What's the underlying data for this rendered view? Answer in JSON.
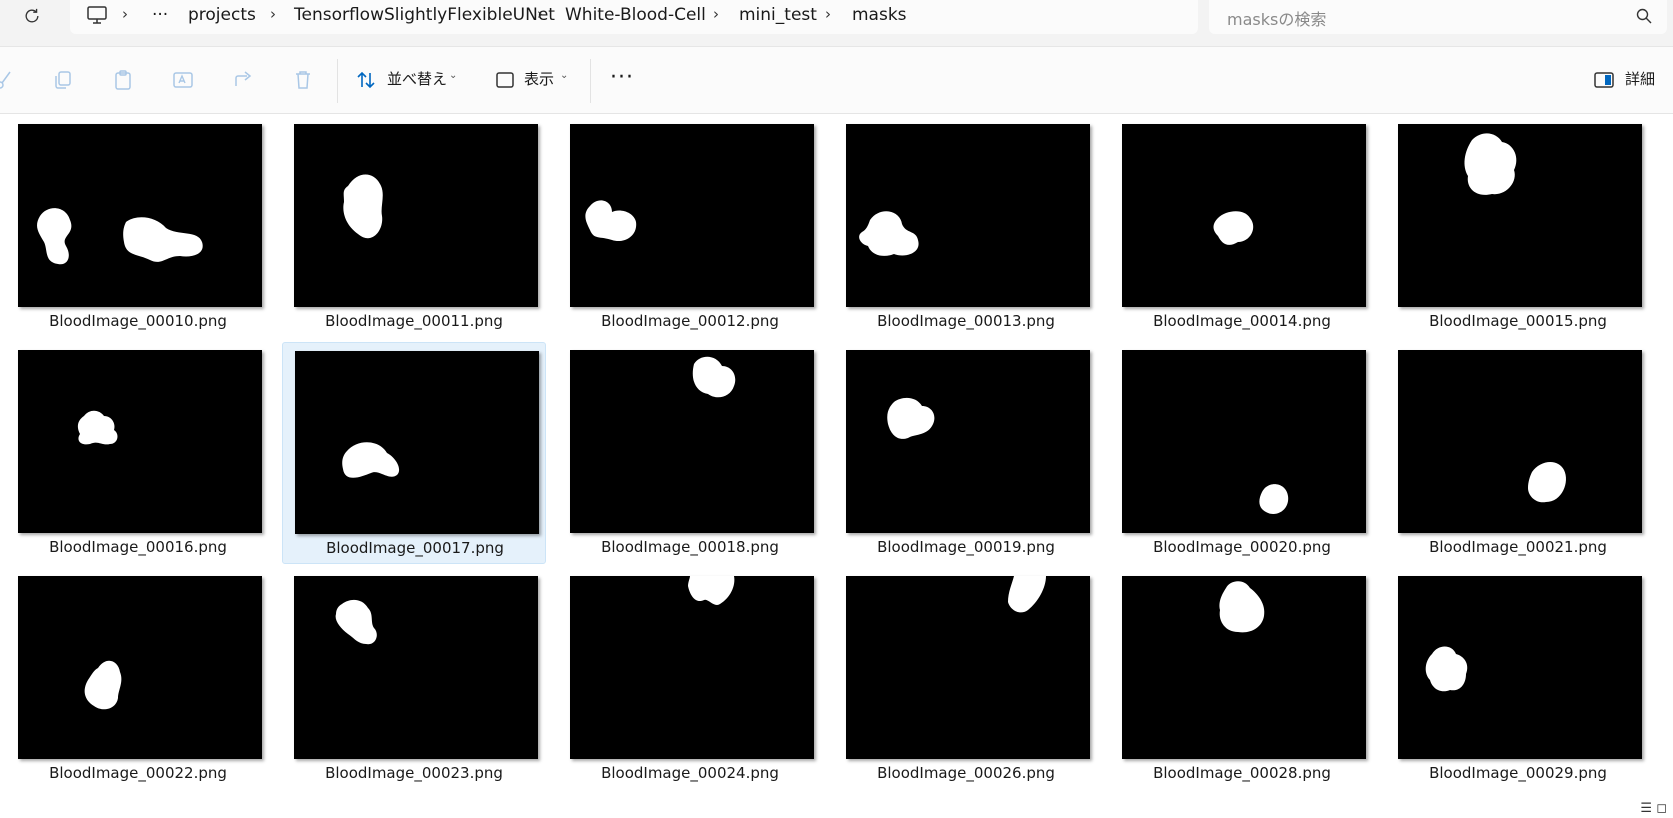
{
  "breadcrumb": {
    "overflow": "···",
    "items": [
      "projects",
      "TensorflowSlightlyFlexibleUNet",
      "White-Blood-Cell",
      "mini_test",
      "masks"
    ]
  },
  "search": {
    "placeholder": "masksの検索"
  },
  "toolbar": {
    "sort_label": "並べ替え",
    "view_label": "表示",
    "more_label": "···",
    "details_label": "詳細"
  },
  "files": [
    {
      "name": "BloodImage_00010.png",
      "selected": false
    },
    {
      "name": "BloodImage_00011.png",
      "selected": false
    },
    {
      "name": "BloodImage_00012.png",
      "selected": false
    },
    {
      "name": "BloodImage_00013.png",
      "selected": false
    },
    {
      "name": "BloodImage_00014.png",
      "selected": false
    },
    {
      "name": "BloodImage_00015.png",
      "selected": false
    },
    {
      "name": "BloodImage_00016.png",
      "selected": false
    },
    {
      "name": "BloodImage_00017.png",
      "selected": true
    },
    {
      "name": "BloodImage_00018.png",
      "selected": false
    },
    {
      "name": "BloodImage_00019.png",
      "selected": false
    },
    {
      "name": "BloodImage_00020.png",
      "selected": false
    },
    {
      "name": "BloodImage_00021.png",
      "selected": false
    },
    {
      "name": "BloodImage_00022.png",
      "selected": false
    },
    {
      "name": "BloodImage_00023.png",
      "selected": false
    },
    {
      "name": "BloodImage_00024.png",
      "selected": false
    },
    {
      "name": "BloodImage_00026.png",
      "selected": false
    },
    {
      "name": "BloodImage_00028.png",
      "selected": false
    },
    {
      "name": "BloodImage_00029.png",
      "selected": false
    }
  ],
  "colors": {
    "accent": "#0067c0",
    "selection": "#e5f1fb",
    "disabled_icon": "#a9c7e6"
  }
}
